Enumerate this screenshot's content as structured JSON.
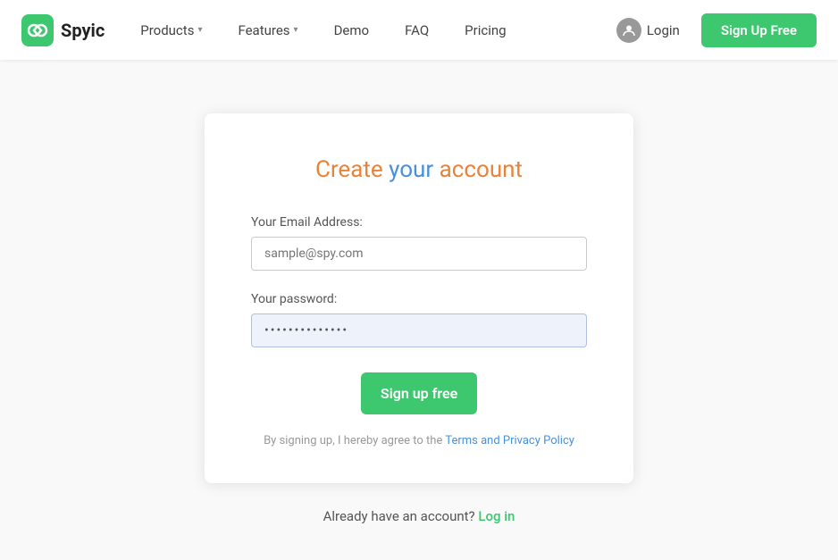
{
  "nav": {
    "logo_text": "Spyic",
    "links": [
      {
        "label": "Products",
        "has_dropdown": true
      },
      {
        "label": "Features",
        "has_dropdown": true
      },
      {
        "label": "Demo",
        "has_dropdown": false
      },
      {
        "label": "FAQ",
        "has_dropdown": false
      },
      {
        "label": "Pricing",
        "has_dropdown": false
      }
    ],
    "login_label": "Login",
    "signup_label": "Sign Up Free"
  },
  "card": {
    "title_create": "Create ",
    "title_your": "your",
    "title_account": " account",
    "email_label": "Your Email Address:",
    "email_placeholder": "sample@spy.com",
    "password_label": "Your password:",
    "password_value": "••••••••••••",
    "signup_btn_label": "Sign up free",
    "terms_text_pre": "By signing up, I hereby agree to the ",
    "terms_link_label": "Terms and Privacy Policy"
  },
  "below_card": {
    "text": "Already have an account?",
    "login_link": "Log in"
  }
}
